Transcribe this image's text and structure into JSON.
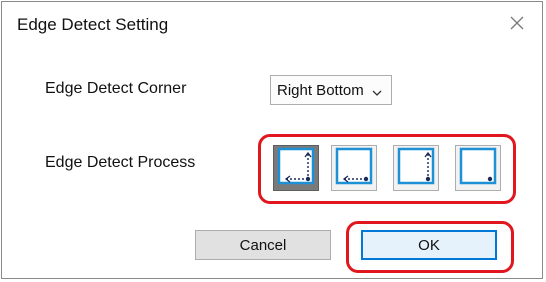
{
  "dialog": {
    "title": "Edge Detect Setting",
    "close_icon": "close-icon"
  },
  "corner": {
    "label": "Edge Detect Corner",
    "selected": "Right Bottom",
    "chevron_icon": "chevron-down-icon"
  },
  "process": {
    "label": "Edge Detect Process",
    "options": [
      {
        "icon": "edge-process-1-icon",
        "selected": true
      },
      {
        "icon": "edge-process-2-icon",
        "selected": false
      },
      {
        "icon": "edge-process-3-icon",
        "selected": false
      },
      {
        "icon": "edge-process-4-icon",
        "selected": false
      }
    ]
  },
  "buttons": {
    "cancel": "Cancel",
    "ok": "OK"
  },
  "colors": {
    "highlight": "#e0171f",
    "accent": "#0078d7",
    "icon_frame": "#1e90d6"
  }
}
